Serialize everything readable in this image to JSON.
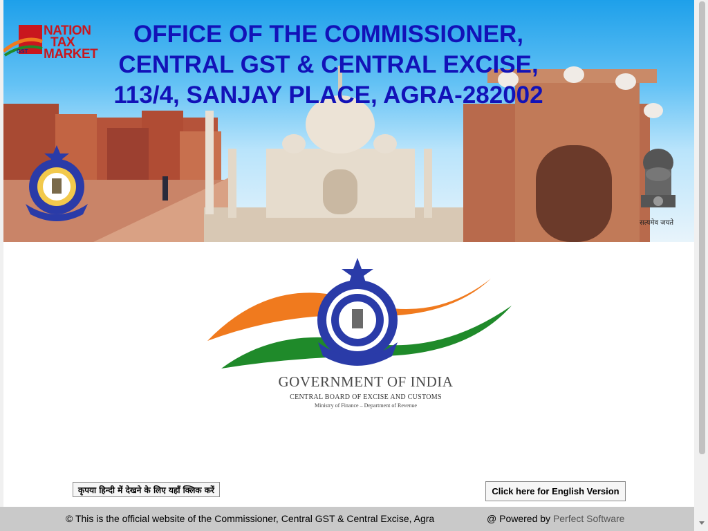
{
  "header": {
    "title_lines": [
      "OFFICE OF THE COMMISSIONER,",
      "CENTRAL GST & CENTRAL EXCISE,",
      "113/4, SANJAY PLACE, AGRA-282002"
    ],
    "gst_logo": {
      "line1": "NATION",
      "line2": "TAX",
      "line3": "MARKET",
      "tag": "GST"
    },
    "emblem_caption": "सत्यमेव जयते"
  },
  "center": {
    "goi_title": "GOVERNMENT OF INDIA",
    "board_line": "CENTRAL BOARD OF EXCISE AND CUSTOMS",
    "ministry_line": "Ministry of Finance – Department of Revenue"
  },
  "buttons": {
    "hindi_label": "कृपया हिन्दी में देखने के लिए यहाँ क्लिक करें",
    "english_label": "Click here for English Version"
  },
  "footer": {
    "copyright": "© This is the official website of the Commissioner, Central GST & Central Excise, Agra",
    "powered_prefix": "@ Powered by",
    "powered_link": "Perfect Software"
  },
  "colors": {
    "title_blue": "#1212b8",
    "footer_bg": "#c9c9c9",
    "saffron": "#f07a1e",
    "green": "#1f8a2a",
    "seal_blue": "#2a3ba8"
  }
}
